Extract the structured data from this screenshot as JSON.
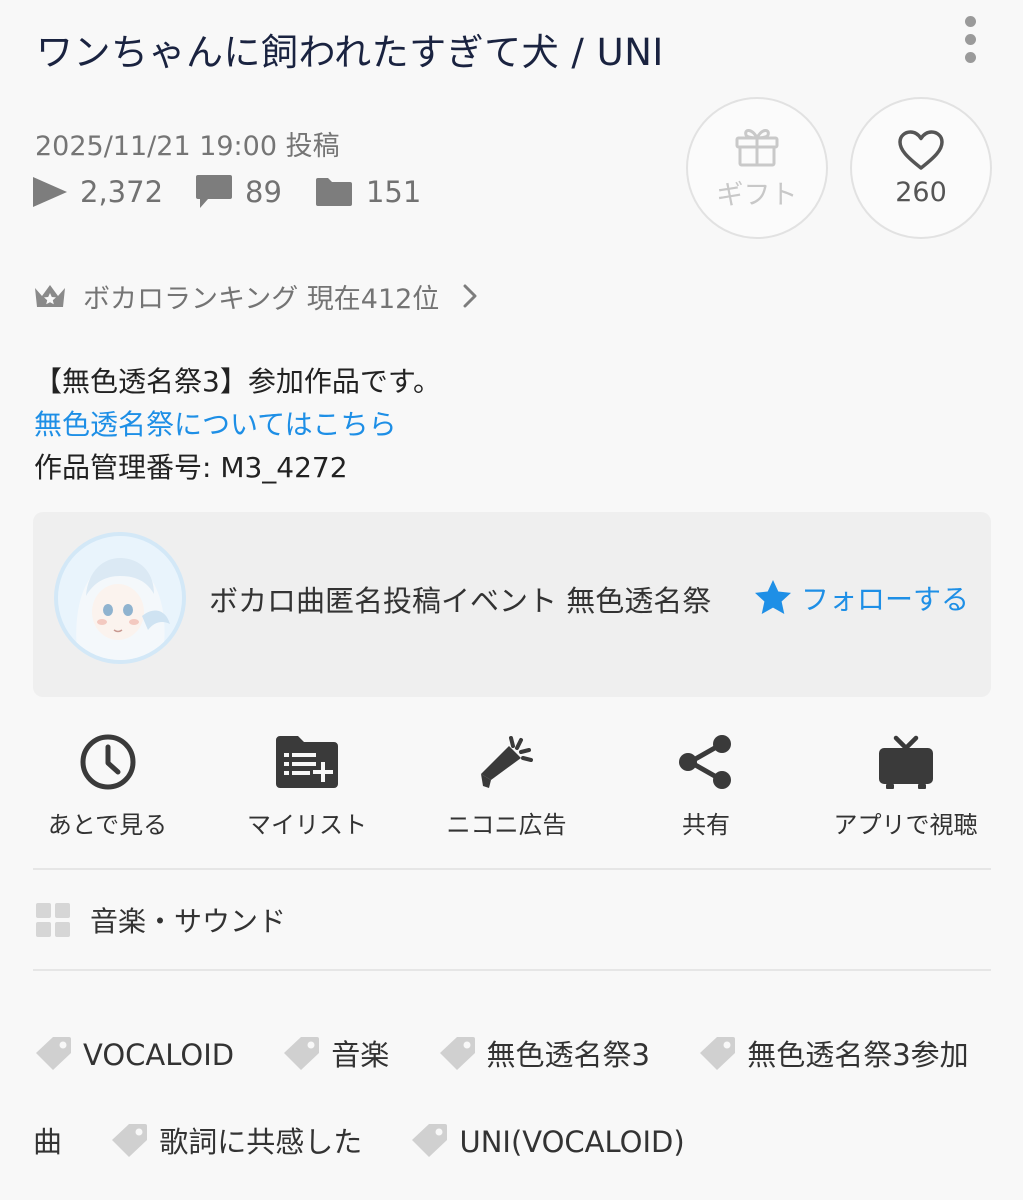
{
  "video": {
    "title": "ワンちゃんに飼われたすぎて犬 / UNI",
    "posted": "2025/11/21 19:00 投稿",
    "views": "2,372",
    "comments": "89",
    "mylists": "151"
  },
  "buttons": {
    "gift_label": "ギフト",
    "like_count": "260"
  },
  "ranking": {
    "text": "ボカロランキング 現在412位"
  },
  "description": {
    "line1": "【無色透名祭3】参加作品です。",
    "link": "無色透名祭についてはこちら",
    "line3": "作品管理番号: M3_4272"
  },
  "owner": {
    "name": "ボカロ曲匿名投稿イベント 無色透名祭",
    "follow_label": "フォローする"
  },
  "actions": [
    {
      "label": "あとで見る",
      "icon": "clock-icon"
    },
    {
      "label": "マイリスト",
      "icon": "mylist-add-icon"
    },
    {
      "label": "ニコニ広告",
      "icon": "megaphone-icon"
    },
    {
      "label": "共有",
      "icon": "share-icon"
    },
    {
      "label": "アプリで視聴",
      "icon": "tv-icon"
    }
  ],
  "category": "音楽・サウンド",
  "tags": [
    "VOCALOID",
    "音楽",
    "無色透名祭3",
    "無色透名祭3参加曲",
    "歌詞に共感した",
    "UNI(VOCALOID)"
  ],
  "colors": {
    "accent": "#1e8fe6",
    "title": "#1a2340",
    "muted": "#757575",
    "icon_dark": "#3a3a3a",
    "background": "#f8f8f8"
  }
}
